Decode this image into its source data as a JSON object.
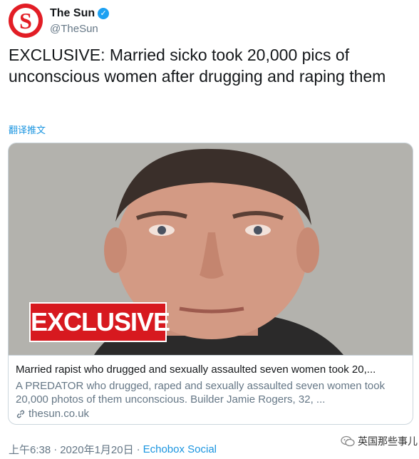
{
  "account": {
    "display_name": "The Sun",
    "handle": "@TheSun",
    "avatar_letter": "S",
    "verified_glyph": "✓",
    "brand_color": "#e21d25"
  },
  "tweet": {
    "text": "EXCLUSIVE: Married sicko took 20,000 pics of unconscious women after drugging and raping them",
    "translate_label": "翻译推文"
  },
  "card": {
    "badge_text": "EXCLUSIVE",
    "title": "Married rapist who drugged and sexually assaulted seven women took 20,...",
    "description": "A PREDATOR who drugged, raped and sexually assaulted seven women took 20,000 photos of them unconscious. Builder Jamie Rogers, 32, ...",
    "domain": "thesun.co.uk",
    "link_icon": "link-icon"
  },
  "footer": {
    "time": "上午6:38",
    "separator": "·",
    "date": "2020年1月20日",
    "source": "Echobox Social"
  },
  "watermark": {
    "text": "英国那些事儿",
    "icon": "wechat-icon"
  },
  "colors": {
    "link": "#1b95e0",
    "secondary_text": "#657786",
    "badge": "#d7191f",
    "verified": "#1da1f2"
  }
}
